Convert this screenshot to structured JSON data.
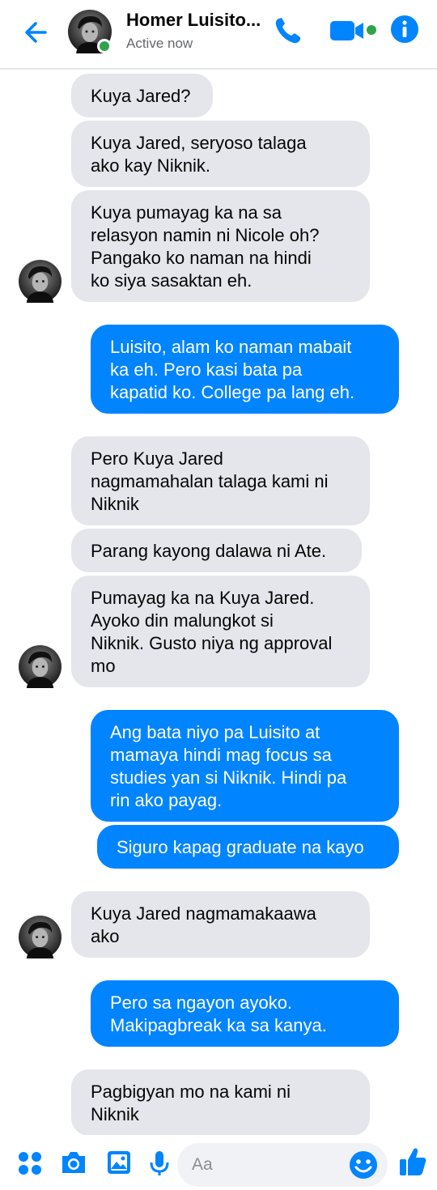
{
  "header": {
    "contact_name": "Homer Luisito...",
    "status": "Active now",
    "icons": [
      "back-arrow-icon",
      "phone-icon",
      "video-camera-icon",
      "info-icon"
    ],
    "accent_color": "#0084ff",
    "online_color": "#31a24c"
  },
  "messages": [
    {
      "from": "contact",
      "text": "Kuya Jared?"
    },
    {
      "from": "contact",
      "text": "Kuya Jared, seryoso talaga\nako kay Niknik."
    },
    {
      "from": "contact",
      "text": "Kuya pumayag ka na sa\nrelasyon namin ni Nicole oh?\nPangako ko naman na hindi\nko siya sasaktan eh."
    },
    {
      "from": "me",
      "text": "Luisito, alam ko naman mabait\nka eh. Pero kasi bata pa\nkapatid ko. College pa lang eh."
    },
    {
      "from": "contact",
      "text": "Pero Kuya Jared\nnagmamahalan talaga kami ni\nNiknik"
    },
    {
      "from": "contact",
      "text": "Parang kayong dalawa ni Ate."
    },
    {
      "from": "contact",
      "text": "Pumayag ka na Kuya Jared.\nAyoko din malungkot si\nNiknik. Gusto niya ng approval\nmo"
    },
    {
      "from": "me",
      "text": "Ang bata niyo pa Luisito at\nmamaya hindi mag focus sa\nstudies yan si Niknik. Hindi pa\nrin ako payag."
    },
    {
      "from": "me",
      "text": "Siguro kapag graduate na kayo"
    },
    {
      "from": "contact",
      "text": "Kuya Jared nagmamakaawa\nako"
    },
    {
      "from": "me",
      "text": "Pero sa ngayon ayoko.\nMakipagbreak ka sa kanya."
    },
    {
      "from": "contact",
      "text": "Pagbigyan mo na kami ni\nNiknik"
    }
  ],
  "composer": {
    "placeholder": "Aa",
    "icons": [
      "apps-grid-icon",
      "camera-icon",
      "gallery-icon",
      "microphone-icon",
      "emoji-icon",
      "thumbs-up-icon"
    ]
  },
  "colors": {
    "incoming_bubble": "#e4e6eb",
    "outgoing_bubble": "#0084ff"
  }
}
